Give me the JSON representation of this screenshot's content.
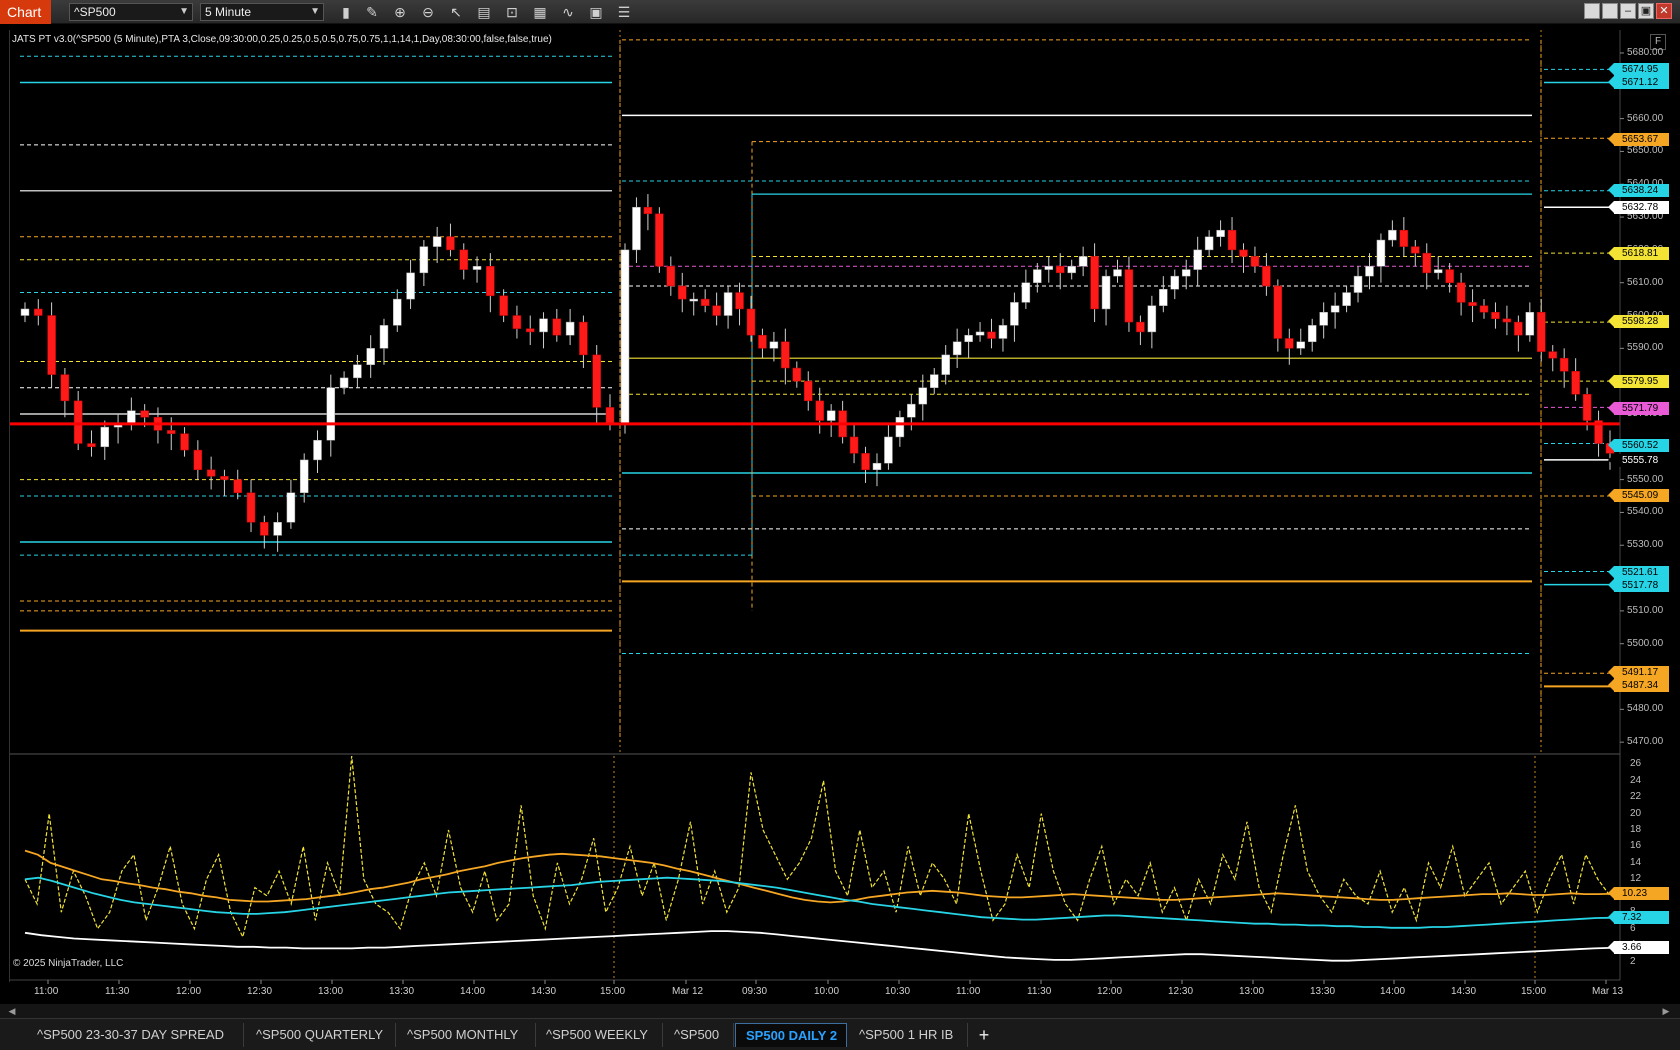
{
  "toolbar": {
    "label": "Chart",
    "instrument": "^SP500",
    "interval": "5 Minute",
    "icons": [
      "bar-type-icon",
      "draw-icon",
      "zoom-in-icon",
      "zoom-out-icon",
      "pointer-icon",
      "data-box-icon",
      "properties-icon",
      "templates-icon",
      "strategies-icon",
      "indicators-icon",
      "menu-icon"
    ],
    "window_buttons": [
      "",
      "",
      "–",
      "▣",
      "✕"
    ]
  },
  "indicator_label": "JATS PT v3.0(^SP500 (5 Minute),PTA 3,Close,09:30:00,0.25,0.25,0.5,0.5,0.75,0.75,1,1,14,1,Day,08:30:00,false,false,true)",
  "f_button": "F",
  "copyright": "© 2025 NinjaTrader, LLC",
  "colors": {
    "up": "#ffffff",
    "down": "#ff1a1a",
    "cyan": "#27d4e6",
    "orange": "#f5a623",
    "yellow": "#f2e335",
    "white": "#ffffff",
    "magenta": "#e85ad6",
    "red_line": "#ff0000"
  },
  "price_axis": {
    "ticks": [
      "5680.00",
      "5670.00",
      "5660.00",
      "5650.00",
      "5640.00",
      "5630.00",
      "5620.00",
      "5610.00",
      "5600.00",
      "5590.00",
      "5580.00",
      "5570.00",
      "5560.00",
      "5550.00",
      "5540.00",
      "5530.00",
      "5520.00",
      "5510.00",
      "5500.00",
      "5490.00",
      "5480.00",
      "5470.00"
    ],
    "tags": [
      {
        "text": "5674.95",
        "color": "#27d4e6"
      },
      {
        "text": "5671.12",
        "color": "#27d4e6"
      },
      {
        "text": "5653.67",
        "color": "#f5a623"
      },
      {
        "text": "5638.24",
        "color": "#27d4e6"
      },
      {
        "text": "5632.78",
        "color": "#ffffff"
      },
      {
        "text": "5618.81",
        "color": "#f2e335"
      },
      {
        "text": "5598.28",
        "color": "#f2e335"
      },
      {
        "text": "5579.95",
        "color": "#f2e335"
      },
      {
        "text": "5571.79",
        "color": "#e85ad6"
      },
      {
        "text": "5560.52",
        "color": "#27d4e6"
      },
      {
        "text": "5555.78",
        "color": "#000000"
      },
      {
        "text": "5545.09",
        "color": "#f5a623"
      },
      {
        "text": "5521.61",
        "color": "#27d4e6"
      },
      {
        "text": "5517.78",
        "color": "#27d4e6"
      },
      {
        "text": "5491.17",
        "color": "#f5a623"
      },
      {
        "text": "5487.34",
        "color": "#f5a623"
      }
    ]
  },
  "lower_axis": {
    "ticks": [
      "26",
      "24",
      "22",
      "20",
      "18",
      "16",
      "14",
      "12",
      "10",
      "8",
      "6",
      "4",
      "2"
    ],
    "tags": [
      {
        "text": "10.23",
        "color": "#f5a623"
      },
      {
        "text": "7.32",
        "color": "#27d4e6"
      },
      {
        "text": "3.66",
        "color": "#ffffff"
      }
    ]
  },
  "time_axis": [
    "11:00",
    "11:30",
    "12:00",
    "12:30",
    "13:00",
    "13:30",
    "14:00",
    "14:30",
    "15:00",
    "Mar 12",
    "09:30",
    "10:00",
    "10:30",
    "11:00",
    "11:30",
    "12:00",
    "12:30",
    "13:00",
    "13:30",
    "14:00",
    "14:30",
    "15:00",
    "Mar 13"
  ],
  "tabs": [
    {
      "label": "^SP500 23-30-37 DAY SPREAD",
      "active": false
    },
    {
      "label": "^SP500 QUARTERLY",
      "active": false
    },
    {
      "label": "^SP500 MONTHLY",
      "active": false
    },
    {
      "label": "^SP500 WEEKLY",
      "active": false
    },
    {
      "label": "^SP500",
      "active": false
    },
    {
      "label": "SP500 DAILY 2",
      "active": true
    },
    {
      "label": "^SP500 1 HR IB",
      "active": false
    }
  ],
  "add_tab": "+",
  "chart_data": {
    "type": "candlestick",
    "instrument": "^SP500",
    "interval": "5 Minute",
    "ylim": [
      5467,
      5687
    ],
    "current_price": 5567,
    "closes": [
      5602,
      5600,
      5582,
      5574,
      5561,
      5560,
      5566,
      5567,
      5571,
      5569,
      5565,
      5564,
      5559,
      5553,
      5551,
      5550,
      5546,
      5537,
      5533,
      5537,
      5546,
      5556,
      5562,
      5578,
      5581,
      5585,
      5590,
      5597,
      5605,
      5613,
      5621,
      5624,
      5620,
      5614,
      5615,
      5606,
      5600,
      5596,
      5595,
      5599,
      5594,
      5598,
      5588,
      5572,
      5567,
      5620,
      5633,
      5631,
      5615,
      5609,
      5605,
      5605,
      5603,
      5600,
      5607,
      5602,
      5594,
      5590,
      5592,
      5584,
      5580,
      5574,
      5568,
      5571,
      5563,
      5558,
      5553,
      5555,
      5563,
      5569,
      5573,
      5578,
      5582,
      5588,
      5592,
      5594,
      5595,
      5593,
      5597,
      5604,
      5610,
      5614,
      5615,
      5613,
      5615,
      5618,
      5602,
      5612,
      5614,
      5598,
      5595,
      5603,
      5608,
      5612,
      5614,
      5620,
      5624,
      5626,
      5620,
      5618,
      5615,
      5609,
      5593,
      5590,
      5592,
      5597,
      5601,
      5603,
      5607,
      5612,
      5615,
      5623,
      5626,
      5621,
      5619,
      5613,
      5614,
      5610,
      5604,
      5603,
      5601,
      5599,
      5598,
      5594,
      5601,
      5589,
      5587,
      5583,
      5576,
      5568,
      5561,
      5558
    ],
    "lower_panel": {
      "ylim": [
        0,
        27
      ],
      "series": [
        {
          "color": "#f2e335",
          "style": "dashed",
          "values": [
            12,
            9,
            20,
            8,
            13,
            10,
            6,
            8,
            13,
            15,
            7,
            11,
            16,
            9,
            6,
            12,
            15,
            8,
            5,
            11,
            10,
            13,
            9,
            16,
            7,
            14,
            10,
            27,
            12,
            9,
            8,
            6,
            11,
            14,
            10,
            18,
            11,
            8,
            13,
            7,
            9,
            21,
            10,
            6,
            14,
            9,
            12,
            17,
            8,
            11,
            16,
            10,
            14,
            7,
            12,
            19,
            9,
            13,
            8,
            11,
            25,
            18,
            15,
            12,
            14,
            17,
            24,
            13,
            10,
            18,
            11,
            13,
            8,
            16,
            10,
            14,
            12,
            9,
            20,
            13,
            7,
            9,
            15,
            11,
            20,
            13,
            9,
            7,
            12,
            16,
            9,
            12,
            10,
            14,
            8,
            11,
            7,
            12,
            9,
            15,
            12,
            19,
            11,
            8,
            15,
            21,
            13,
            10,
            8,
            12,
            10,
            9,
            13,
            8,
            11,
            7,
            14,
            11,
            16,
            10,
            12,
            14,
            9,
            11,
            13,
            8,
            12,
            15,
            9,
            15,
            12,
            10
          ]
        },
        {
          "color": "#f5a623",
          "style": "solid",
          "values": [
            15.5,
            15,
            14,
            13.5,
            13,
            12.5,
            12,
            11.8,
            11.5,
            11.3,
            11,
            10.8,
            10.5,
            10.3,
            10,
            9.8,
            9.5,
            9.4,
            9.3,
            9.3,
            9.4,
            9.5,
            9.6,
            9.8,
            10,
            10.2,
            10.5,
            10.8,
            11,
            11.3,
            11.6,
            12,
            12.3,
            12.6,
            13,
            13.3,
            13.6,
            14,
            14.3,
            14.6,
            14.8,
            15,
            15.1,
            15,
            14.9,
            14.8,
            14.6,
            14.4,
            14.2,
            14,
            13.7,
            13.3,
            13,
            12.6,
            12.2,
            11.8,
            11.4,
            11,
            10.6,
            10.2,
            9.8,
            9.5,
            9.3,
            9.2,
            9.3,
            9.5,
            9.8,
            10,
            10.2,
            10.4,
            10.5,
            10.6,
            10.5,
            10.4,
            10.2,
            10,
            9.9,
            9.8,
            9.8,
            9.9,
            10,
            10.1,
            10.2,
            10.1,
            10,
            9.9,
            9.8,
            9.7,
            9.6,
            9.5,
            9.5,
            9.6,
            9.7,
            9.8,
            9.9,
            10,
            10.1,
            10.2,
            10.3,
            10.2,
            10.1,
            10,
            9.9,
            9.8,
            9.7,
            9.6,
            9.5,
            9.5,
            9.6,
            9.7,
            9.8,
            9.9,
            10,
            10.1,
            10.2,
            10.2,
            10.3,
            10.2,
            10.1,
            10.1,
            10.2,
            10.3,
            10.2,
            10.2,
            10.23
          ]
        },
        {
          "color": "#27d4e6",
          "style": "solid",
          "values": [
            12,
            12.2,
            11.8,
            11.3,
            10.8,
            10.3,
            9.9,
            9.5,
            9.2,
            9,
            8.8,
            8.6,
            8.4,
            8.2,
            8,
            7.9,
            7.8,
            7.8,
            7.9,
            8,
            8.2,
            8.4,
            8.6,
            8.8,
            9,
            9.2,
            9.4,
            9.6,
            9.8,
            10,
            10.2,
            10.4,
            10.5,
            10.6,
            10.7,
            10.8,
            10.9,
            11,
            11.1,
            11.2,
            11.3,
            11.5,
            11.7,
            11.8,
            11.9,
            12,
            12.1,
            12.2,
            12.1,
            12,
            11.9,
            11.8,
            11.6,
            11.4,
            11.2,
            11,
            10.7,
            10.4,
            10.1,
            9.8,
            9.5,
            9.3,
            9,
            8.8,
            8.6,
            8.4,
            8.2,
            8,
            7.8,
            7.6,
            7.4,
            7.3,
            7.2,
            7.1,
            7.1,
            7.2,
            7.3,
            7.4,
            7.5,
            7.6,
            7.6,
            7.5,
            7.4,
            7.3,
            7.2,
            7.1,
            7,
            6.9,
            6.8,
            6.7,
            6.6,
            6.6,
            6.5,
            6.5,
            6.4,
            6.4,
            6.3,
            6.3,
            6.2,
            6.2,
            6.1,
            6.1,
            6.1,
            6.2,
            6.2,
            6.3,
            6.4,
            6.5,
            6.6,
            6.7,
            6.8,
            6.9,
            7,
            7.1,
            7.2,
            7.3,
            7.32
          ]
        },
        {
          "color": "#ffffff",
          "style": "solid",
          "values": [
            5.5,
            5.2,
            5,
            4.8,
            4.7,
            4.6,
            4.5,
            4.4,
            4.3,
            4.2,
            4.1,
            4,
            3.9,
            3.8,
            3.8,
            3.7,
            3.7,
            3.6,
            3.6,
            3.6,
            3.6,
            3.7,
            3.7,
            3.8,
            3.9,
            4,
            4.1,
            4.2,
            4.3,
            4.4,
            4.5,
            4.6,
            4.7,
            4.8,
            4.9,
            5,
            5.1,
            5.2,
            5.3,
            5.4,
            5.5,
            5.6,
            5.7,
            5.7,
            5.6,
            5.5,
            5.3,
            5.1,
            4.9,
            4.7,
            4.5,
            4.3,
            4.1,
            3.9,
            3.7,
            3.5,
            3.3,
            3.1,
            2.9,
            2.7,
            2.5,
            2.4,
            2.3,
            2.2,
            2.2,
            2.3,
            2.4,
            2.5,
            2.6,
            2.7,
            2.8,
            2.9,
            2.9,
            2.8,
            2.7,
            2.6,
            2.5,
            2.4,
            2.3,
            2.2,
            2.1,
            2.1,
            2.2,
            2.3,
            2.4,
            2.5,
            2.6,
            2.7,
            2.8,
            2.9,
            3,
            3.1,
            3.2,
            3.3,
            3.4,
            3.5,
            3.6,
            3.66
          ]
        }
      ]
    }
  }
}
